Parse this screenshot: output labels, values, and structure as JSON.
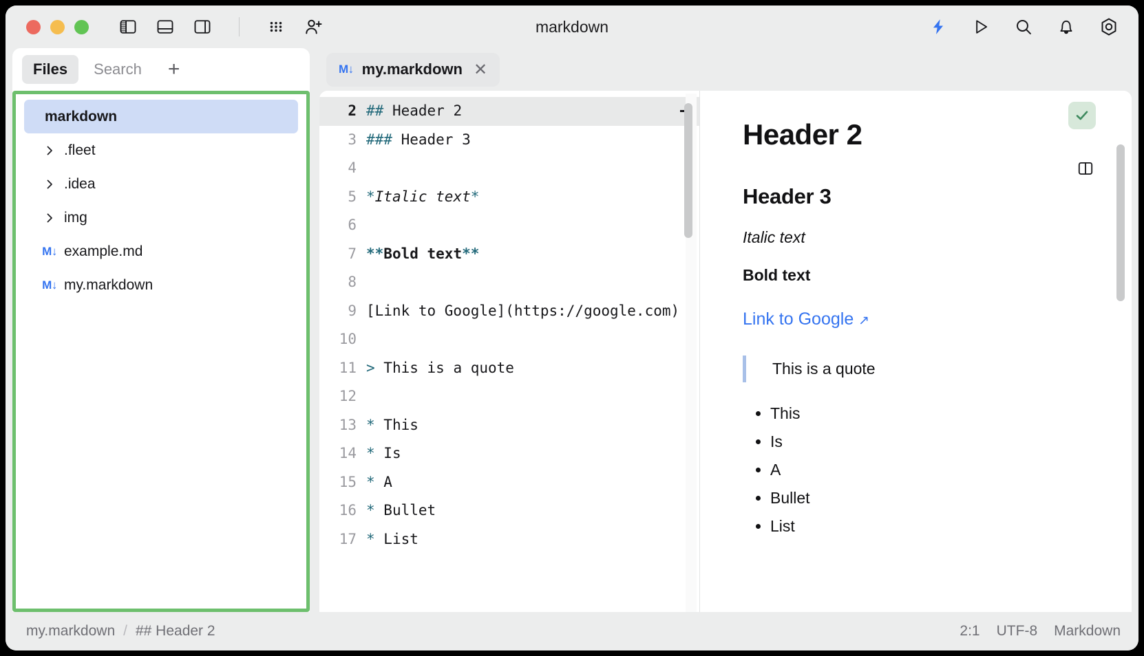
{
  "window": {
    "title": "markdown",
    "traffic_lights": [
      "close",
      "minimize",
      "zoom"
    ],
    "colors": {
      "accent_blue": "#3574f0",
      "highlight_green": "#6dbf6d",
      "markup_teal": "#22697a",
      "selection_blue": "#cfdcf6",
      "check_badge_bg": "#d7e8da",
      "check_mark": "#3f8a5f"
    }
  },
  "titlebar": {
    "left_icons": [
      {
        "name": "left-panel-toggle-icon",
        "label": "Toggle left panel"
      },
      {
        "name": "bottom-panel-toggle-icon",
        "label": "Toggle bottom panel"
      },
      {
        "name": "right-panel-toggle-icon",
        "label": "Toggle right panel"
      },
      {
        "name": "grid-menu-icon",
        "label": "Grid menu"
      },
      {
        "name": "add-person-icon",
        "label": "Invite collaborator"
      }
    ],
    "right_icons": [
      {
        "name": "lightning-icon",
        "label": "Smart mode"
      },
      {
        "name": "run-icon",
        "label": "Run"
      },
      {
        "name": "search-icon",
        "label": "Search everywhere"
      },
      {
        "name": "notifications-bell-icon",
        "label": "Notifications"
      },
      {
        "name": "settings-gear-icon",
        "label": "Settings"
      }
    ]
  },
  "sidebar": {
    "tabs": [
      {
        "label": "Files",
        "active": true
      },
      {
        "label": "Search",
        "active": false
      }
    ],
    "add_button": "+",
    "tree": [
      {
        "label": "markdown",
        "kind": "root",
        "selected": true,
        "icon": "none"
      },
      {
        "label": ".fleet",
        "kind": "folder",
        "selected": false,
        "icon": "chevron-right-icon"
      },
      {
        "label": ".idea",
        "kind": "folder",
        "selected": false,
        "icon": "chevron-right-icon"
      },
      {
        "label": "img",
        "kind": "folder",
        "selected": false,
        "icon": "chevron-right-icon"
      },
      {
        "label": "example.md",
        "kind": "file",
        "selected": false,
        "icon": "markdown-file-icon"
      },
      {
        "label": "my.markdown",
        "kind": "file",
        "selected": false,
        "icon": "markdown-file-icon"
      }
    ],
    "md_icon_glyph": "M↓"
  },
  "editor": {
    "tab": {
      "label": "my.markdown",
      "icon": "markdown-file-icon",
      "close": "✕"
    },
    "lines": [
      {
        "no": "2",
        "active": true,
        "segments": [
          {
            "t": "## ",
            "c": "mk"
          },
          {
            "t": "Header 2",
            "c": ""
          }
        ]
      },
      {
        "no": "3",
        "active": false,
        "segments": [
          {
            "t": "### ",
            "c": "mk"
          },
          {
            "t": "Header 3",
            "c": ""
          }
        ]
      },
      {
        "no": "4",
        "active": false,
        "segments": []
      },
      {
        "no": "5",
        "active": false,
        "segments": [
          {
            "t": "*",
            "c": "mk i"
          },
          {
            "t": "Italic text",
            "c": "i"
          },
          {
            "t": "*",
            "c": "mk i"
          }
        ]
      },
      {
        "no": "6",
        "active": false,
        "segments": []
      },
      {
        "no": "7",
        "active": false,
        "segments": [
          {
            "t": "**",
            "c": "mk b"
          },
          {
            "t": "Bold text",
            "c": "b"
          },
          {
            "t": "**",
            "c": "mk b"
          }
        ]
      },
      {
        "no": "8",
        "active": false,
        "segments": []
      },
      {
        "no": "9",
        "active": false,
        "segments": [
          {
            "t": "[Link to Google](https://google.com)",
            "c": ""
          }
        ]
      },
      {
        "no": "10",
        "active": false,
        "segments": []
      },
      {
        "no": "11",
        "active": false,
        "segments": [
          {
            "t": "> ",
            "c": "mk"
          },
          {
            "t": "This is a quote",
            "c": ""
          }
        ]
      },
      {
        "no": "12",
        "active": false,
        "segments": []
      },
      {
        "no": "13",
        "active": false,
        "segments": [
          {
            "t": "* ",
            "c": "mk"
          },
          {
            "t": "This",
            "c": ""
          }
        ]
      },
      {
        "no": "14",
        "active": false,
        "segments": [
          {
            "t": "* ",
            "c": "mk"
          },
          {
            "t": "Is",
            "c": ""
          }
        ]
      },
      {
        "no": "15",
        "active": false,
        "segments": [
          {
            "t": "* ",
            "c": "mk"
          },
          {
            "t": "A",
            "c": ""
          }
        ]
      },
      {
        "no": "16",
        "active": false,
        "segments": [
          {
            "t": "* ",
            "c": "mk"
          },
          {
            "t": "Bullet",
            "c": ""
          }
        ]
      },
      {
        "no": "17",
        "active": false,
        "segments": [
          {
            "t": "* ",
            "c": "mk"
          },
          {
            "t": "List",
            "c": ""
          }
        ]
      }
    ]
  },
  "preview": {
    "check_badge": "✓",
    "split_icon": "split-view-icon",
    "header2": "Header 2",
    "header3": "Header 3",
    "italic_text": "Italic text",
    "bold_text": "Bold text",
    "link_text": "Link to Google",
    "link_arrow": "↗",
    "quote": "This is a quote",
    "list": [
      "This",
      "Is",
      "A",
      "Bullet",
      "List"
    ]
  },
  "statusbar": {
    "file": "my.markdown",
    "separator": "/",
    "breadcrumb": "## Header 2",
    "caret": "2:1",
    "encoding": "UTF-8",
    "language": "Markdown"
  }
}
